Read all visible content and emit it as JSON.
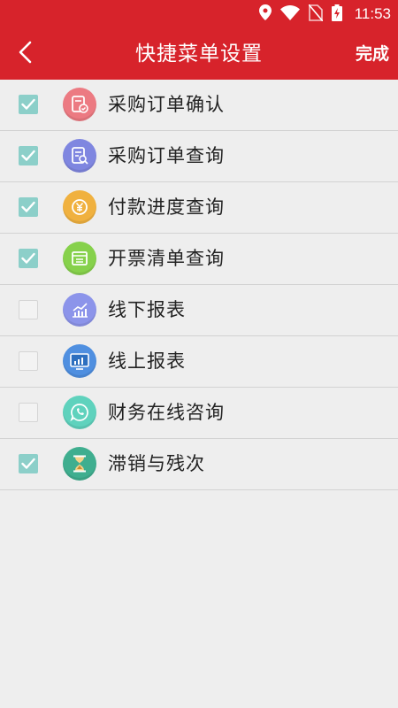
{
  "status_bar": {
    "time": "11:53",
    "icons": [
      "location-icon",
      "wifi-icon",
      "no-sim-icon",
      "battery-charging-icon"
    ]
  },
  "header": {
    "title": "快捷菜单设置",
    "done_label": "完成",
    "back_icon": "chevron-left-icon",
    "background_color": "#d7232b"
  },
  "menu": {
    "items": [
      {
        "label": "采购订单确认",
        "checked": true,
        "icon": "order-confirm-icon",
        "color": "#ec7a82"
      },
      {
        "label": "采购订单查询",
        "checked": true,
        "icon": "order-search-icon",
        "color": "#7f86e0"
      },
      {
        "label": "付款进度查询",
        "checked": true,
        "icon": "yuan-coin-icon",
        "color": "#f0b13f"
      },
      {
        "label": "开票清单查询",
        "checked": true,
        "icon": "invoice-icon",
        "color": "#86d14b"
      },
      {
        "label": "线下报表",
        "checked": false,
        "icon": "line-chart-icon",
        "color": "#8c94ea"
      },
      {
        "label": "线上报表",
        "checked": false,
        "icon": "monitor-chart-icon",
        "color": "#4f8fe0"
      },
      {
        "label": "财务在线咨询",
        "checked": false,
        "icon": "phone-chat-icon",
        "color": "#5fd2bd"
      },
      {
        "label": "滞销与残次",
        "checked": true,
        "icon": "hourglass-icon",
        "color": "#3fae8f"
      }
    ]
  },
  "checkbox_checked_color": "#8ccfc9"
}
